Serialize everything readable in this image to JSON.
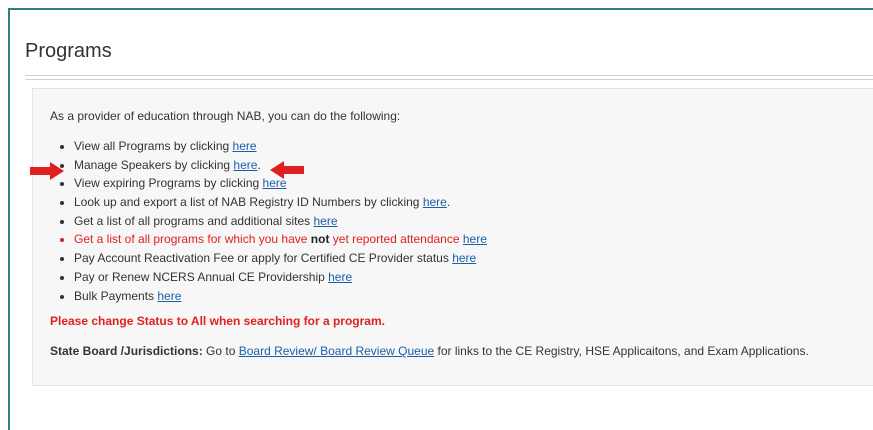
{
  "page": {
    "title": "Programs"
  },
  "panel": {
    "intro": "As a provider of education through NAB, you can do the following:",
    "items": [
      {
        "pre": "View all Programs by clicking ",
        "link": "here",
        "post": ""
      },
      {
        "pre": "Manage Speakers by clicking ",
        "link": "here",
        "post": "."
      },
      {
        "pre": "View expiring Programs by clicking ",
        "link": "here",
        "post": ""
      },
      {
        "pre": "Look up and export a list of NAB Registry ID Numbers by clicking ",
        "link": "here",
        "post": "."
      },
      {
        "pre": "Get a list of all programs and additional sites ",
        "link": "here",
        "post": ""
      },
      {
        "pre": "Get a list of all programs for which you have ",
        "bold": "not",
        "mid": " yet reported attendance ",
        "link": "here",
        "post": ""
      },
      {
        "pre": "Pay Account Reactivation Fee or apply for Certified CE Provider status ",
        "link": "here",
        "post": ""
      },
      {
        "pre": "Pay or Renew NCERS Annual CE Providership ",
        "link": "here",
        "post": ""
      },
      {
        "pre": "Bulk Payments ",
        "link": "here",
        "post": ""
      }
    ],
    "warning": "Please change Status to All when searching for a program.",
    "state": {
      "label": "State Board /Jurisdictions:",
      "pre": " Go to ",
      "link": "Board Review/ Board Review Queue",
      "post": " for links to the CE Registry, HSE Applicaitons, and Exam Applications."
    }
  },
  "colors": {
    "frame": "#2e7f82",
    "link": "#1a5fa8",
    "alert": "#e02020",
    "arrow": "#e02020"
  },
  "icons": [
    "right-arrow-icon",
    "left-arrow-icon"
  ]
}
